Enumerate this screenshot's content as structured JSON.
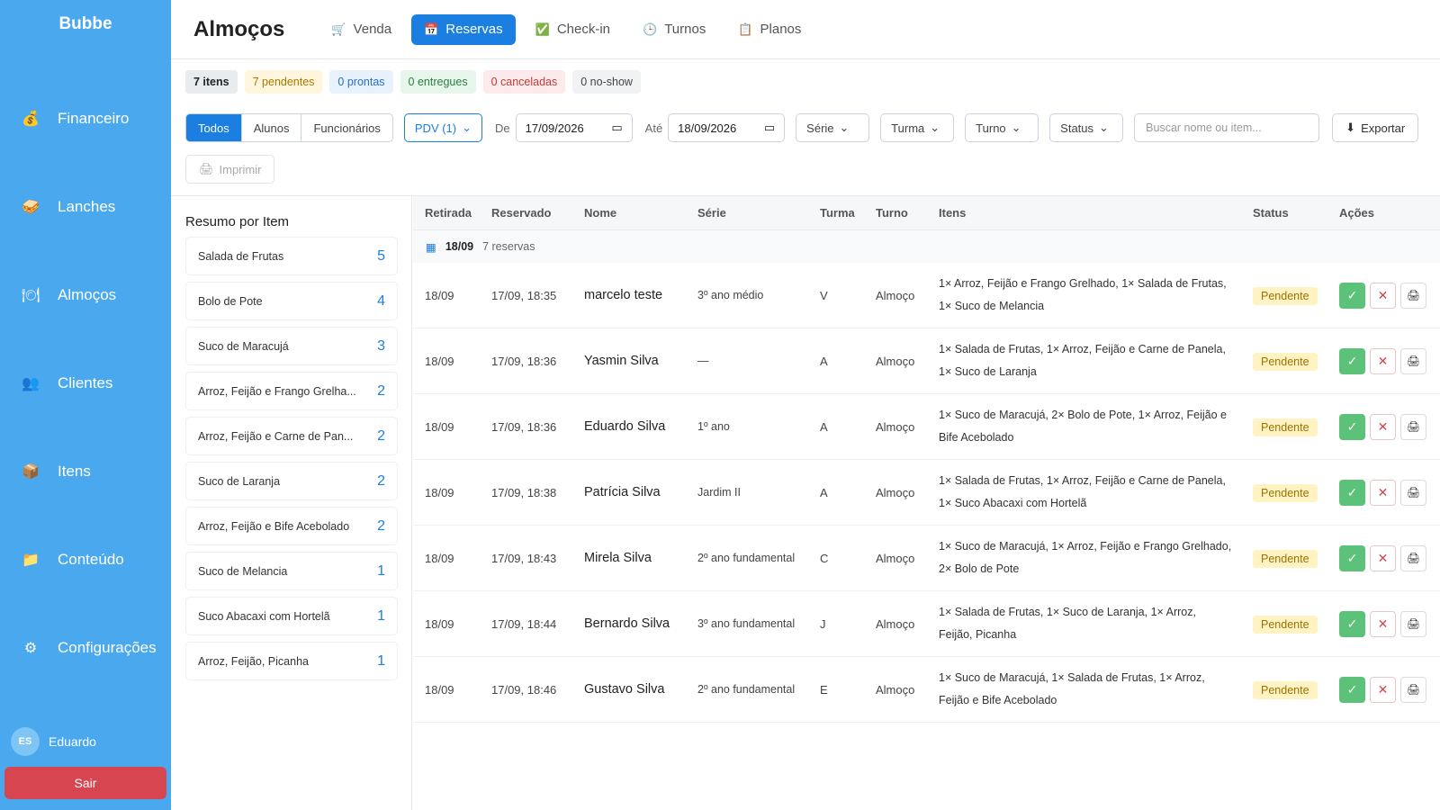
{
  "sidebar": {
    "brand": "Bubbe",
    "items": [
      {
        "label": "Financeiro",
        "icon": "money-bag-icon"
      },
      {
        "label": "Lanches",
        "icon": "sandwich-icon"
      },
      {
        "label": "Almoços",
        "icon": "plate-icon"
      },
      {
        "label": "Clientes",
        "icon": "people-icon"
      },
      {
        "label": "Itens",
        "icon": "box-icon"
      },
      {
        "label": "Conteúdo",
        "icon": "folder-icon"
      },
      {
        "label": "Configurações",
        "icon": "gear-icon"
      }
    ],
    "user": {
      "initials": "ES",
      "name": "Eduardo"
    },
    "logout_label": "Sair"
  },
  "header": {
    "title": "Almoços",
    "tabs": [
      {
        "label": "Venda",
        "icon": "cart-icon"
      },
      {
        "label": "Reservas",
        "icon": "calendar-icon",
        "active": true
      },
      {
        "label": "Check-in",
        "icon": "checkbox-icon"
      },
      {
        "label": "Turnos",
        "icon": "clock-icon"
      },
      {
        "label": "Planos",
        "icon": "clipboard-icon"
      }
    ]
  },
  "counts": {
    "items": "7 itens",
    "pending": "7 pendentes",
    "ready": "0 prontas",
    "delivered": "0 entregues",
    "cancelled": "0 canceladas",
    "noshow": "0 no-show"
  },
  "filters": {
    "segments": [
      "Todos",
      "Alunos",
      "Funcionários"
    ],
    "pdv": "PDV (1)",
    "from_label": "De",
    "from_date": "17/09/2026",
    "to_label": "Até",
    "to_date": "18/09/2026",
    "serie": "Série",
    "turma": "Turma",
    "turno": "Turno",
    "status": "Status",
    "search_placeholder": "Buscar nome ou item...",
    "export_label": "Exportar",
    "print_label": "Imprimir"
  },
  "summary": {
    "title": "Resumo por Item",
    "items": [
      {
        "name": "Salada de Frutas",
        "qty": "5"
      },
      {
        "name": "Bolo de Pote",
        "qty": "4"
      },
      {
        "name": "Suco de Maracujá",
        "qty": "3"
      },
      {
        "name": "Arroz, Feijão e Frango Grelha...",
        "qty": "2"
      },
      {
        "name": "Arroz, Feijão e Carne de Pan...",
        "qty": "2"
      },
      {
        "name": "Suco de Laranja",
        "qty": "2"
      },
      {
        "name": "Arroz, Feijão e Bife Acebolado",
        "qty": "2"
      },
      {
        "name": "Suco de Melancia",
        "qty": "1"
      },
      {
        "name": "Suco Abacaxi com Hortelã",
        "qty": "1"
      },
      {
        "name": "Arroz, Feijão, Picanha",
        "qty": "1"
      }
    ]
  },
  "table": {
    "headers": {
      "retirada": "Retirada",
      "reservado": "Reservado",
      "nome": "Nome",
      "serie": "Série",
      "turma": "Turma",
      "turno": "Turno",
      "itens": "Itens",
      "status": "Status",
      "acoes": "Ações"
    },
    "group": {
      "date": "18/09",
      "count": "7 reservas"
    },
    "rows": [
      {
        "retirada": "18/09",
        "reservado": "17/09, 18:35",
        "nome": "marcelo teste",
        "serie": "3º ano médio",
        "turma": "V",
        "turno": "Almoço",
        "itens": "1× Arroz, Feijão e Frango Grelhado, 1× Salada de Frutas, 1× Suco de Melancia",
        "status": "Pendente"
      },
      {
        "retirada": "18/09",
        "reservado": "17/09, 18:36",
        "nome": "Yasmin Silva",
        "serie": "—",
        "turma": "A",
        "turno": "Almoço",
        "itens": "1× Salada de Frutas, 1× Arroz, Feijão e Carne de Panela, 1× Suco de Laranja",
        "status": "Pendente"
      },
      {
        "retirada": "18/09",
        "reservado": "17/09, 18:36",
        "nome": "Eduardo Silva",
        "serie": "1º ano",
        "turma": "A",
        "turno": "Almoço",
        "itens": "1× Suco de Maracujá, 2× Bolo de Pote, 1× Arroz, Feijão e Bife Acebolado",
        "status": "Pendente"
      },
      {
        "retirada": "18/09",
        "reservado": "17/09, 18:38",
        "nome": "Patrícia Silva",
        "serie": "Jardim II",
        "turma": "A",
        "turno": "Almoço",
        "itens": "1× Salada de Frutas, 1× Arroz, Feijão e Carne de Panela, 1× Suco Abacaxi com Hortelã",
        "status": "Pendente"
      },
      {
        "retirada": "18/09",
        "reservado": "17/09, 18:43",
        "nome": "Mirela Silva",
        "serie": "2º ano fundamental",
        "turma": "C",
        "turno": "Almoço",
        "itens": "1× Suco de Maracujá, 1× Arroz, Feijão e Frango Grelhado, 2× Bolo de Pote",
        "status": "Pendente"
      },
      {
        "retirada": "18/09",
        "reservado": "17/09, 18:44",
        "nome": "Bernardo Silva",
        "serie": "3º ano fundamental",
        "turma": "J",
        "turno": "Almoço",
        "itens": "1× Salada de Frutas, 1× Suco de Laranja, 1× Arroz, Feijão, Picanha",
        "status": "Pendente"
      },
      {
        "retirada": "18/09",
        "reservado": "17/09, 18:46",
        "nome": "Gustavo Silva",
        "serie": "2º ano fundamental",
        "turma": "E",
        "turno": "Almoço",
        "itens": "1× Suco de Maracujá, 1× Salada de Frutas, 1× Arroz, Feijão e Bife Acebolado",
        "status": "Pendente"
      }
    ]
  },
  "colors": {
    "sidebar": "#4aa8ee",
    "accent": "#1a7fe0",
    "logout": "#d64550",
    "confirm": "#5cc27a",
    "pending_badge": "#fff3c4"
  }
}
